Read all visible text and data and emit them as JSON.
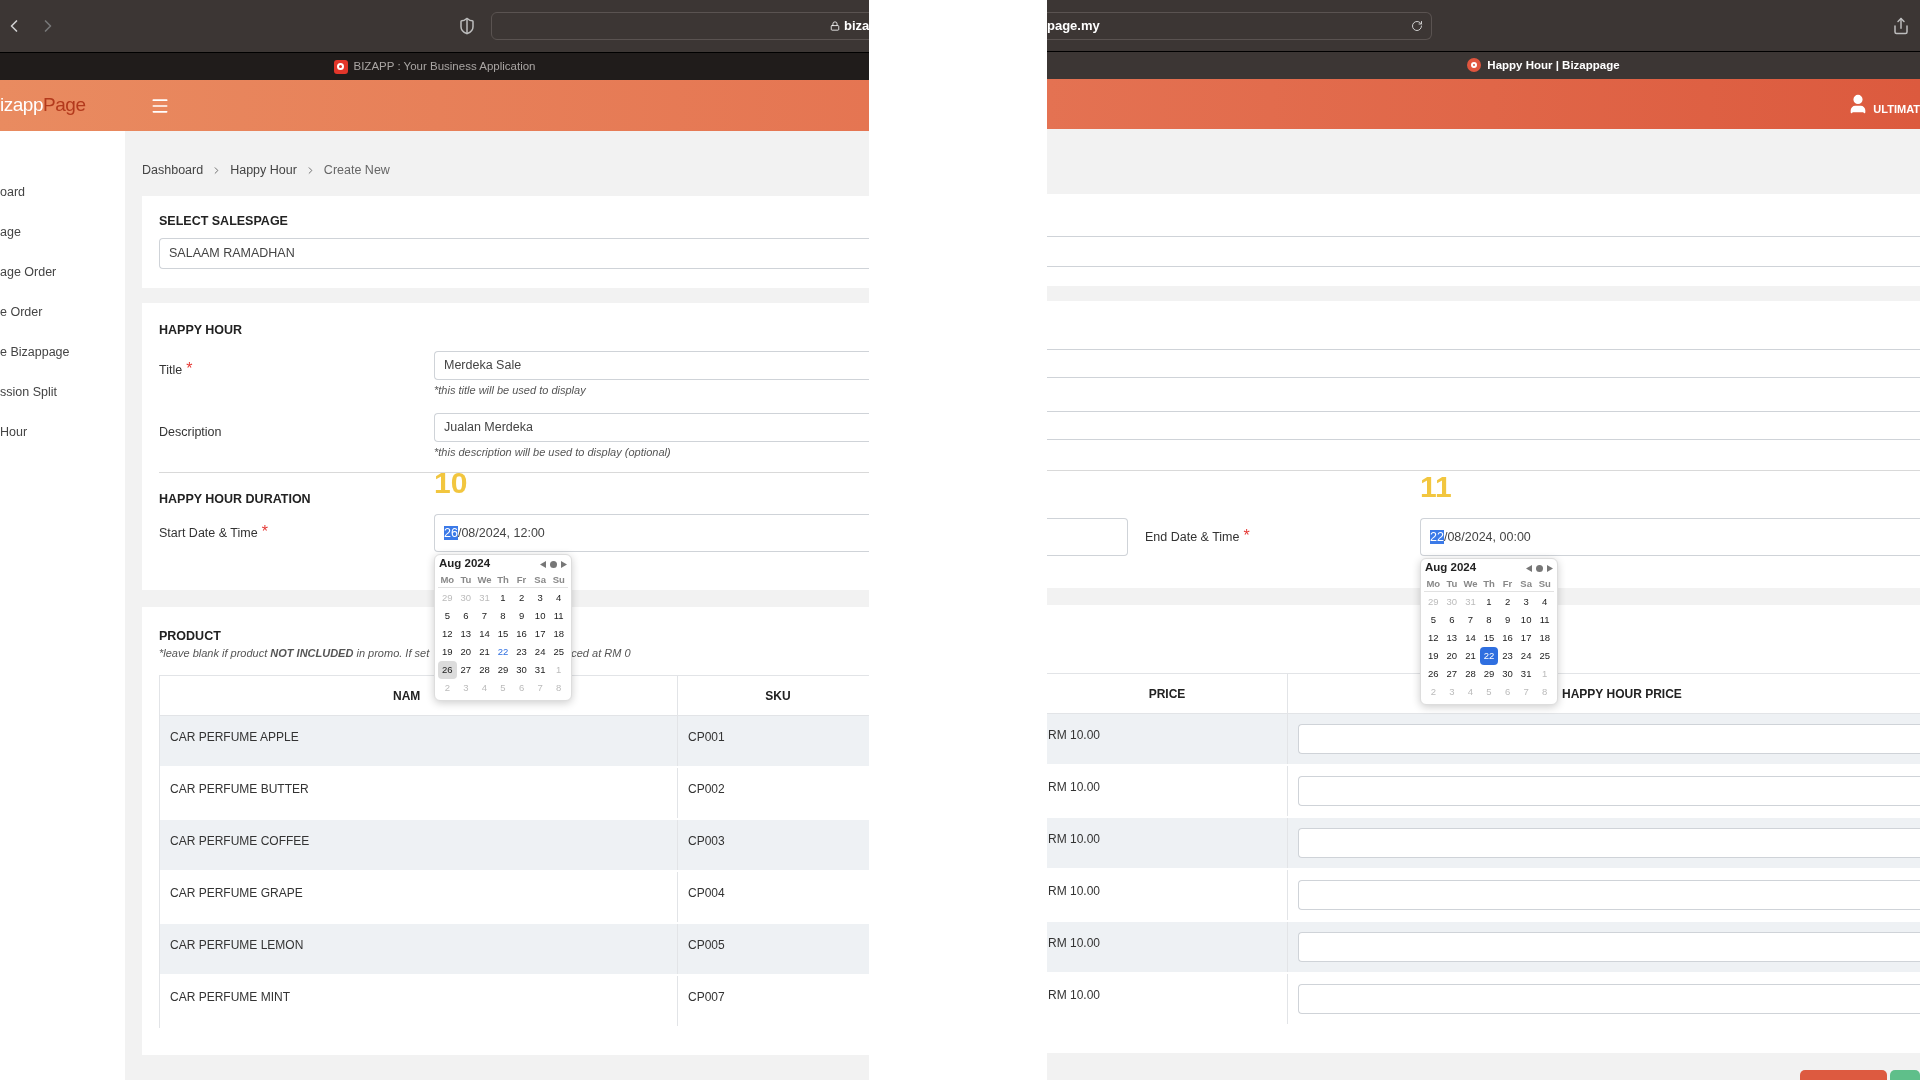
{
  "browser": {
    "url_start": "biza",
    "url_end": "page.my",
    "tabs": [
      {
        "title": "BIZAPP : Your Business Application",
        "selected": false
      },
      {
        "title": "Happy Hour | Bizappage",
        "selected": true
      }
    ]
  },
  "header": {
    "logo": "izapp",
    "logo_accent": "Page",
    "user": "ULTIMAT"
  },
  "sidebar": {
    "items": [
      "oard",
      "age",
      "age Order",
      "e Order",
      "e Bizappage",
      "ssion Split",
      "Hour"
    ]
  },
  "breadcrumb": [
    "Dashboard",
    "Happy Hour",
    "Create New"
  ],
  "salespage": {
    "heading": "SELECT SALESPAGE",
    "value": "SALAAM RAMADHAN"
  },
  "happy_hour": {
    "heading": "HAPPY HOUR",
    "fields": [
      {
        "label": "Title",
        "required_mark": "*",
        "value": "Merdeka Sale",
        "hint": "*this title will be used to display"
      },
      {
        "label": "Description",
        "value": "Jualan Merdeka",
        "hint": "*this description will be used to display (optional)"
      }
    ]
  },
  "duration": {
    "heading": "HAPPY HOUR DURATION",
    "pickers": [
      {
        "label": "Start Date & Time",
        "required_mark": "*",
        "annotation": "10",
        "value_highlighted": "26",
        "value_rest": "/08/2024, 12:00",
        "calendar": {
          "month": "Aug 2024",
          "weekdays": [
            "Mo",
            "Tu",
            "We",
            "Th",
            "Fr",
            "Sa",
            "Su"
          ],
          "weeks": [
            [
              {
                "d": "29",
                "muted": true,
                "today": false,
                "selected": false
              },
              {
                "d": "30",
                "muted": true,
                "today": false,
                "selected": false
              },
              {
                "d": "31",
                "muted": true,
                "today": false,
                "selected": false
              },
              {
                "d": "1",
                "muted": false,
                "today": false,
                "selected": false
              },
              {
                "d": "2",
                "muted": false,
                "today": false,
                "selected": false
              },
              {
                "d": "3",
                "muted": false,
                "today": false,
                "selected": false
              },
              {
                "d": "4",
                "muted": false,
                "today": false,
                "selected": false
              }
            ],
            [
              {
                "d": "5",
                "muted": false,
                "today": false,
                "selected": false
              },
              {
                "d": "6",
                "muted": false,
                "today": false,
                "selected": false
              },
              {
                "d": "7",
                "muted": false,
                "today": false,
                "selected": false
              },
              {
                "d": "8",
                "muted": false,
                "today": false,
                "selected": false
              },
              {
                "d": "9",
                "muted": false,
                "today": false,
                "selected": false
              },
              {
                "d": "10",
                "muted": false,
                "today": false,
                "selected": false
              },
              {
                "d": "11",
                "muted": false,
                "today": false,
                "selected": false
              }
            ],
            [
              {
                "d": "12",
                "muted": false,
                "today": false,
                "selected": false
              },
              {
                "d": "13",
                "muted": false,
                "today": false,
                "selected": false
              },
              {
                "d": "14",
                "muted": false,
                "today": false,
                "selected": false
              },
              {
                "d": "15",
                "muted": false,
                "today": false,
                "selected": false
              },
              {
                "d": "16",
                "muted": false,
                "today": false,
                "selected": false
              },
              {
                "d": "17",
                "muted": false,
                "today": false,
                "selected": false
              },
              {
                "d": "18",
                "muted": false,
                "today": false,
                "selected": false
              }
            ],
            [
              {
                "d": "19",
                "muted": false,
                "today": false,
                "selected": false
              },
              {
                "d": "20",
                "muted": false,
                "today": false,
                "selected": false
              },
              {
                "d": "21",
                "muted": false,
                "today": false,
                "selected": false
              },
              {
                "d": "22",
                "muted": false,
                "today": true,
                "selected": false
              },
              {
                "d": "23",
                "muted": false,
                "today": false,
                "selected": false
              },
              {
                "d": "24",
                "muted": false,
                "today": false,
                "selected": false
              },
              {
                "d": "25",
                "muted": false,
                "today": false,
                "selected": false
              }
            ],
            [
              {
                "d": "26",
                "muted": false,
                "today": false,
                "selected": true
              },
              {
                "d": "27",
                "muted": false,
                "today": false,
                "selected": false
              },
              {
                "d": "28",
                "muted": false,
                "today": false,
                "selected": false
              },
              {
                "d": "29",
                "muted": false,
                "today": false,
                "selected": false
              },
              {
                "d": "30",
                "muted": false,
                "today": false,
                "selected": false
              },
              {
                "d": "31",
                "muted": false,
                "today": false,
                "selected": false
              },
              {
                "d": "1",
                "muted": true,
                "today": false,
                "selected": false
              }
            ],
            [
              {
                "d": "2",
                "muted": true,
                "today": false,
                "selected": false
              },
              {
                "d": "3",
                "muted": true,
                "today": false,
                "selected": false
              },
              {
                "d": "4",
                "muted": true,
                "today": false,
                "selected": false
              },
              {
                "d": "5",
                "muted": true,
                "today": false,
                "selected": false
              },
              {
                "d": "6",
                "muted": true,
                "today": false,
                "selected": false
              },
              {
                "d": "7",
                "muted": true,
                "today": false,
                "selected": false
              },
              {
                "d": "8",
                "muted": true,
                "today": false,
                "selected": false
              }
            ]
          ]
        }
      },
      {
        "label": "End Date & Time",
        "required_mark": "*",
        "annotation": "11",
        "value_highlighted": "22",
        "value_rest": "/08/2024, 00:00",
        "calendar": {
          "month": "Aug 2024",
          "weekdays": [
            "Mo",
            "Tu",
            "We",
            "Th",
            "Fr",
            "Sa",
            "Su"
          ],
          "weeks": [
            [
              {
                "d": "29",
                "muted": true,
                "today": false,
                "selected": false
              },
              {
                "d": "30",
                "muted": true,
                "today": false,
                "selected": false
              },
              {
                "d": "31",
                "muted": true,
                "today": false,
                "selected": false
              },
              {
                "d": "1",
                "muted": false,
                "today": false,
                "selected": false
              },
              {
                "d": "2",
                "muted": false,
                "today": false,
                "selected": false
              },
              {
                "d": "3",
                "muted": false,
                "today": false,
                "selected": false
              },
              {
                "d": "4",
                "muted": false,
                "today": false,
                "selected": false
              }
            ],
            [
              {
                "d": "5",
                "muted": false,
                "today": false,
                "selected": false
              },
              {
                "d": "6",
                "muted": false,
                "today": false,
                "selected": false
              },
              {
                "d": "7",
                "muted": false,
                "today": false,
                "selected": false
              },
              {
                "d": "8",
                "muted": false,
                "today": false,
                "selected": false
              },
              {
                "d": "9",
                "muted": false,
                "today": false,
                "selected": false
              },
              {
                "d": "10",
                "muted": false,
                "today": false,
                "selected": false
              },
              {
                "d": "11",
                "muted": false,
                "today": false,
                "selected": false
              }
            ],
            [
              {
                "d": "12",
                "muted": false,
                "today": false,
                "selected": false
              },
              {
                "d": "13",
                "muted": false,
                "today": false,
                "selected": false
              },
              {
                "d": "14",
                "muted": false,
                "today": false,
                "selected": false
              },
              {
                "d": "15",
                "muted": false,
                "today": false,
                "selected": false
              },
              {
                "d": "16",
                "muted": false,
                "today": false,
                "selected": false
              },
              {
                "d": "17",
                "muted": false,
                "today": false,
                "selected": false
              },
              {
                "d": "18",
                "muted": false,
                "today": false,
                "selected": false
              }
            ],
            [
              {
                "d": "19",
                "muted": false,
                "today": false,
                "selected": false
              },
              {
                "d": "20",
                "muted": false,
                "today": false,
                "selected": false
              },
              {
                "d": "21",
                "muted": false,
                "today": false,
                "selected": false
              },
              {
                "d": "22",
                "muted": false,
                "today": true,
                "selected": true
              },
              {
                "d": "23",
                "muted": false,
                "today": false,
                "selected": false
              },
              {
                "d": "24",
                "muted": false,
                "today": false,
                "selected": false
              },
              {
                "d": "25",
                "muted": false,
                "today": false,
                "selected": false
              }
            ],
            [
              {
                "d": "26",
                "muted": false,
                "today": false,
                "selected": false
              },
              {
                "d": "27",
                "muted": false,
                "today": false,
                "selected": false
              },
              {
                "d": "28",
                "muted": false,
                "today": false,
                "selected": false
              },
              {
                "d": "29",
                "muted": false,
                "today": false,
                "selected": false
              },
              {
                "d": "30",
                "muted": false,
                "today": false,
                "selected": false
              },
              {
                "d": "31",
                "muted": false,
                "today": false,
                "selected": false
              },
              {
                "d": "1",
                "muted": true,
                "today": false,
                "selected": false
              }
            ],
            [
              {
                "d": "2",
                "muted": true,
                "today": false,
                "selected": false
              },
              {
                "d": "3",
                "muted": true,
                "today": false,
                "selected": false
              },
              {
                "d": "4",
                "muted": true,
                "today": false,
                "selected": false
              },
              {
                "d": "5",
                "muted": true,
                "today": false,
                "selected": false
              },
              {
                "d": "6",
                "muted": true,
                "today": false,
                "selected": false
              },
              {
                "d": "7",
                "muted": true,
                "today": false,
                "selected": false
              },
              {
                "d": "8",
                "muted": true,
                "today": false,
                "selected": false
              }
            ]
          ]
        }
      }
    ]
  },
  "product": {
    "heading": "PRODUCT",
    "note_start": "*leave blank if product **NOT INCLUDED** in promo. If set",
    "note_end": "ced at RM 0",
    "columns": [
      "NAM",
      "SKU",
      "PRICE",
      "HAPPY HOUR PRICE"
    ],
    "rows": [
      {
        "name": "CAR PERFUME APPLE",
        "sku": "CP001",
        "price": "RM 10.00"
      },
      {
        "name": "CAR PERFUME BUTTER",
        "sku": "CP002",
        "price": "RM 10.00"
      },
      {
        "name": "CAR PERFUME COFFEE",
        "sku": "CP003",
        "price": "RM 10.00"
      },
      {
        "name": "CAR PERFUME GRAPE",
        "sku": "CP004",
        "price": "RM 10.00"
      },
      {
        "name": "CAR PERFUME LEMON",
        "sku": "CP005",
        "price": "RM 10.00"
      },
      {
        "name": "CAR PERFUME MINT",
        "sku": "CP007",
        "price": "RM 10.00"
      }
    ]
  },
  "buttons": [
    {
      "color": "#dd5a40"
    },
    {
      "color": "#5fbf8a"
    }
  ]
}
